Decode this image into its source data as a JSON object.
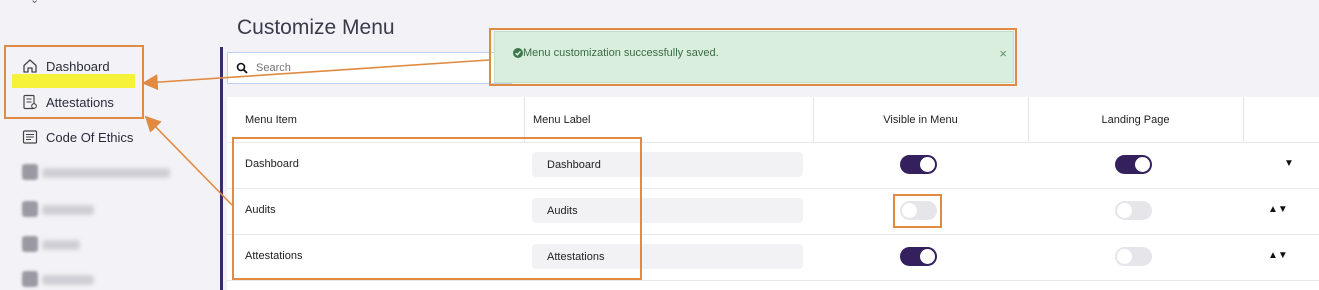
{
  "page": {
    "title": "Customize Menu"
  },
  "sidebar": {
    "items": [
      {
        "label": "Dashboard",
        "icon": "home-icon"
      },
      {
        "label": "Attestations",
        "icon": "attestation-icon"
      },
      {
        "label": "Code Of Ethics",
        "icon": "document-icon"
      }
    ]
  },
  "search": {
    "placeholder": "Search"
  },
  "toast": {
    "message": "Menu customization successfully saved.",
    "close": "×"
  },
  "table": {
    "headers": [
      "Menu Item",
      "Menu Label",
      "Visible in Menu",
      "Landing Page"
    ],
    "rows": [
      {
        "item": "Dashboard",
        "label": "Dashboard",
        "visible": true,
        "landing": true,
        "arrows": "▼"
      },
      {
        "item": "Audits",
        "label": "Audits",
        "visible": false,
        "landing": false,
        "arrows": "▲▼"
      },
      {
        "item": "Attestations",
        "label": "Attestations",
        "visible": true,
        "landing": false,
        "arrows": "▲▼"
      }
    ]
  },
  "colors": {
    "accent": "#33205c",
    "highlight": "#e08a42",
    "toast_bg": "#d9eedd",
    "marker": "#f6f23a"
  }
}
